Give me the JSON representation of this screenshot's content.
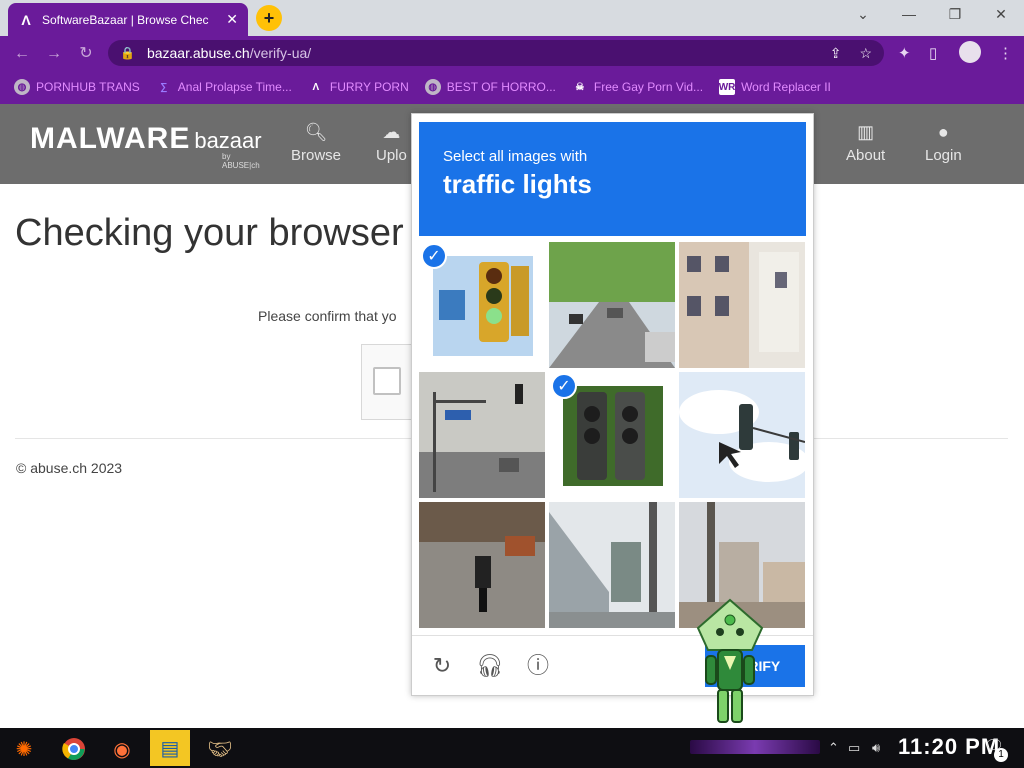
{
  "browser": {
    "tab_title": "SoftwareBazaar | Browse Chec",
    "tab_favicon": "Λ",
    "new_tab_label": "+",
    "url_host": "bazaar.abuse.ch",
    "url_path": "/verify-ua/",
    "window_controls": [
      "⌄",
      "—",
      "❐",
      "✕"
    ],
    "bookmarks": [
      {
        "label": "PORNHUB TRANS",
        "icon": "globe-icon"
      },
      {
        "label": "Anal Prolapse Time...",
        "icon": "bracket-icon"
      },
      {
        "label": "FURRY PORN",
        "icon": "lambda-icon"
      },
      {
        "label": "BEST OF HORRO...",
        "icon": "globe-icon"
      },
      {
        "label": "Free Gay Porn Vid...",
        "icon": "skull-icon"
      },
      {
        "label": "Word Replacer II",
        "icon": "wr-icon"
      }
    ]
  },
  "site": {
    "logo_main": "MALWARE",
    "logo_sub": "bazaar",
    "logo_by": "by ABUSE|ch",
    "nav": [
      {
        "label": "Browse",
        "icon": "search-icon"
      },
      {
        "label": "Uplo",
        "icon": "upload-icon"
      },
      {
        "label": "About",
        "icon": "building-icon"
      },
      {
        "label": "Login",
        "icon": "user-icon"
      }
    ],
    "page_title": "Checking your browser",
    "confirm_text": "Please confirm that yo",
    "copyright": "© abuse.ch 2023"
  },
  "captcha": {
    "prompt_line1": "Select all images with",
    "prompt_line2": "traffic lights",
    "tiles": [
      {
        "subject": "traffic-light-closeup",
        "selected": true
      },
      {
        "subject": "street-with-trees",
        "selected": false
      },
      {
        "subject": "building-corner",
        "selected": false
      },
      {
        "subject": "intersection-street",
        "selected": false
      },
      {
        "subject": "traffic-light-dark",
        "selected": true
      },
      {
        "subject": "traffic-light-sky",
        "selected": false
      },
      {
        "subject": "motorcycle-road",
        "selected": false
      },
      {
        "subject": "overpass-street",
        "selected": false
      },
      {
        "subject": "city-buildings",
        "selected": false
      }
    ],
    "verify_label": "VERIFY",
    "accent_color": "#1a73e8"
  },
  "taskbar": {
    "clock": "11:20 PM",
    "notification_count": "1"
  }
}
